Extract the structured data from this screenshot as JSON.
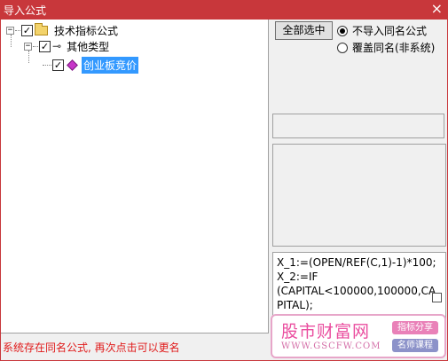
{
  "window": {
    "title": "导入公式",
    "close_glyph": "×"
  },
  "tree": {
    "expander_glyph": "−",
    "check_glyph": "✓",
    "nodes": [
      {
        "label": "技术指标公式",
        "checked": true,
        "icon": "folder-icon"
      },
      {
        "label": "其他类型",
        "checked": true,
        "icon": "key-icon"
      },
      {
        "label": "创业板竞价",
        "checked": true,
        "icon": "diamond-icon",
        "selected": true
      }
    ],
    "key_glyph": "⊸"
  },
  "buttons": {
    "select_all": "全部选中"
  },
  "radios": [
    {
      "label": "不导入同名公式",
      "checked": true
    },
    {
      "label": "覆盖同名(非系统)",
      "checked": false
    }
  ],
  "code": {
    "lines": [
      "X_1:=(OPEN/REF(C,1)-1)*100;",
      "X_2:=IF",
      "(CAPITAL<100000,100000,CA",
      "PITAL);"
    ]
  },
  "status": {
    "message": "系统存在同名公式, 再次点击可以更名"
  },
  "watermark": {
    "name": "股市财富网",
    "url": "WWW.GSCFW.COM",
    "tag1": "指标分享",
    "tag2": "名师课程",
    "colors": {
      "pink": "#ea4e9f",
      "tag_pink": "#e981b8",
      "tag_blue": "#8c92c9"
    }
  },
  "colors": {
    "titlebar": "#c8373b",
    "selection": "#3399ff",
    "status_text": "#e01a1a"
  }
}
